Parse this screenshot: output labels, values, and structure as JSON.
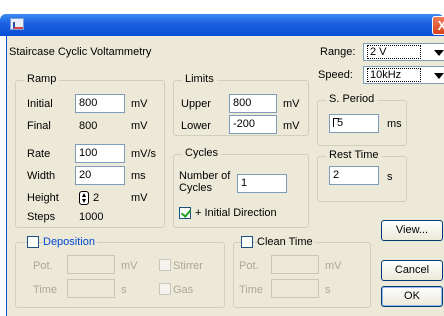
{
  "window": {
    "title_icon": "app-icon",
    "close_glyph": "X",
    "heading": "Staircase Cyclic Voltammetry"
  },
  "range": {
    "label": "Range:",
    "value": "2 V"
  },
  "speed": {
    "label": "Speed:",
    "value": "10kHz"
  },
  "s_period": {
    "title": "S. Period",
    "value": "5",
    "unit": "ms"
  },
  "rest_time": {
    "title": "Rest Time",
    "value": "2",
    "unit": "s"
  },
  "ramp": {
    "title": "Ramp",
    "initial": {
      "label": "Initial",
      "value": "800",
      "unit": "mV"
    },
    "final": {
      "label": "Final",
      "value": "800",
      "unit": "mV"
    },
    "rate": {
      "label": "Rate",
      "value": "100",
      "unit": "mV/s"
    },
    "width": {
      "label": "Width",
      "value": "20",
      "unit": "ms"
    },
    "height": {
      "label": "Height",
      "value": "2",
      "unit": "mV"
    },
    "steps": {
      "label": "Steps",
      "value": "1000"
    }
  },
  "limits": {
    "title": "Limits",
    "upper": {
      "label": "Upper",
      "value": "800",
      "unit": "mV"
    },
    "lower": {
      "label": "Lower",
      "value": "-200",
      "unit": "mV"
    }
  },
  "cycles": {
    "title": "Cycles",
    "number_label_1": "Number of",
    "number_label_2": "Cycles",
    "number_value": "1",
    "initial_direction_label": "+ Initial Direction",
    "initial_direction_checked": true
  },
  "deposition": {
    "title": "Deposition",
    "checked": false,
    "pot_label": "Pot.",
    "pot_unit": "mV",
    "time_label": "Time",
    "time_unit": "s",
    "stirrer_label": "Stirrer",
    "gas_label": "Gas"
  },
  "clean_time": {
    "title": "Clean Time",
    "checked": false,
    "pot_label": "Pot.",
    "pot_unit": "mV",
    "time_label": "Time",
    "time_unit": "s"
  },
  "buttons": {
    "view": "View...",
    "cancel": "Cancel",
    "ok": "OK"
  },
  "colors": {
    "titlebar": "#0a4fd8",
    "client_bg": "#ece9d8",
    "group_title_blue": "#0046d5"
  }
}
